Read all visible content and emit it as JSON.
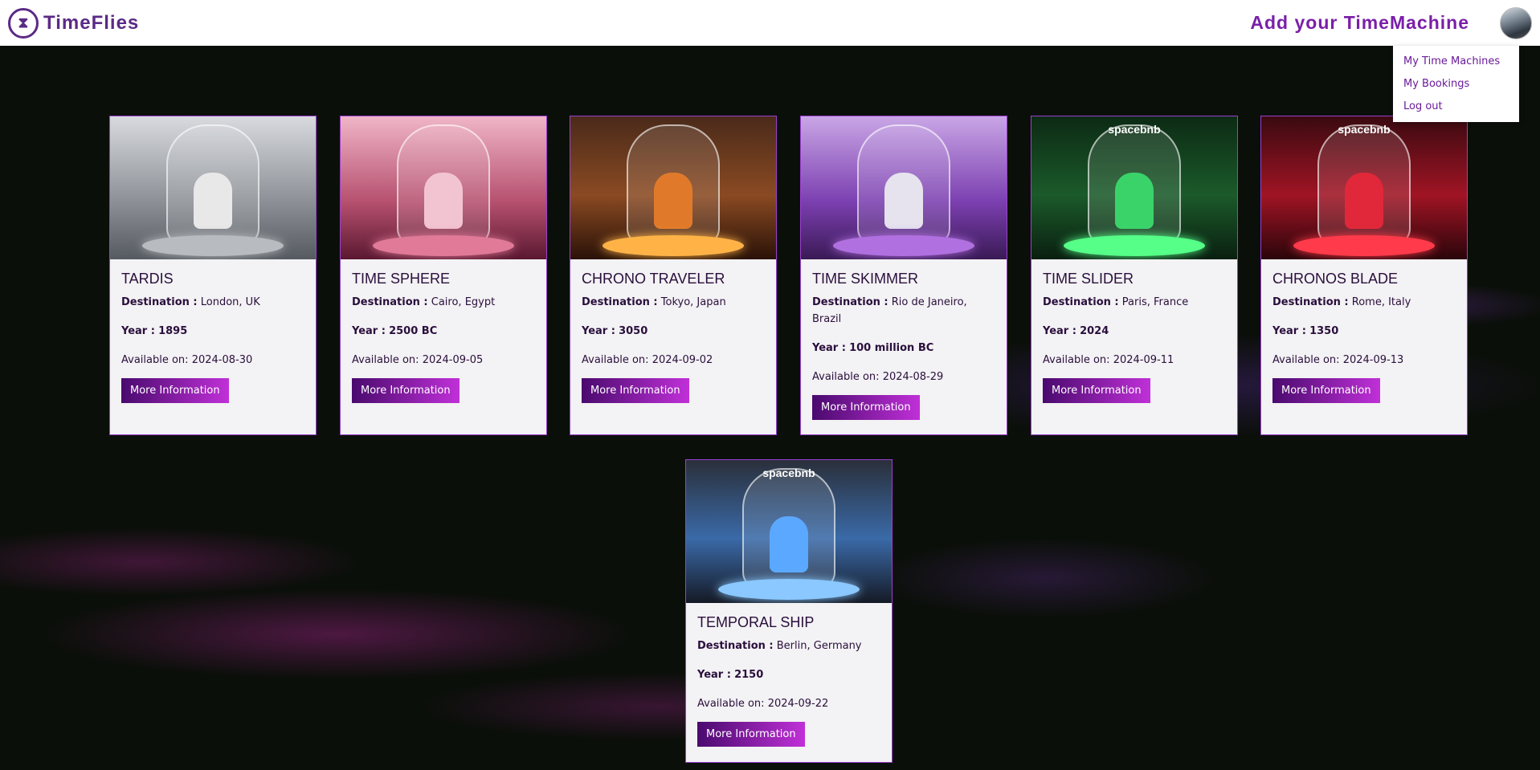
{
  "nav": {
    "brand": "TimeFlies",
    "add_link": "Add your TimeMachine",
    "dropdown": [
      "My Time Machines",
      "My Bookings",
      "Log out"
    ]
  },
  "labels": {
    "destination": "Destination :",
    "year": "Year :",
    "available": "Available on:",
    "more_info": "More Information"
  },
  "colors": {
    "accent": "#7a1fa8",
    "button_from": "#4a0a6e",
    "button_to": "#c030d8",
    "card_border": "#9b40d0"
  },
  "cards": [
    {
      "title": "TARDIS",
      "destination": "London, UK",
      "year": "1895",
      "available": "2024-08-30",
      "theme": "silver"
    },
    {
      "title": "TIME SPHERE",
      "destination": "Cairo, Egypt",
      "year": "2500 BC",
      "available": "2024-09-05",
      "theme": "pink"
    },
    {
      "title": "CHRONO TRAVELER",
      "destination": "Tokyo, Japan",
      "year": "3050",
      "available": "2024-09-02",
      "theme": "orange"
    },
    {
      "title": "TIME SKIMMER",
      "destination": "Rio de Janeiro, Brazil",
      "year": "100 million BC",
      "available": "2024-08-29",
      "theme": "purple"
    },
    {
      "title": "TIME SLIDER",
      "destination": "Paris, France",
      "year": "2024",
      "available": "2024-09-11",
      "theme": "green",
      "img_text": "spacebnb"
    },
    {
      "title": "CHRONOS BLADE",
      "destination": "Rome, Italy",
      "year": "1350",
      "available": "2024-09-13",
      "theme": "red",
      "img_text": "spacebnb"
    },
    {
      "title": "TEMPORAL SHIP",
      "destination": "Berlin, Germany",
      "year": "2150",
      "available": "2024-09-22",
      "theme": "blue",
      "img_text": "spacebnb"
    }
  ]
}
